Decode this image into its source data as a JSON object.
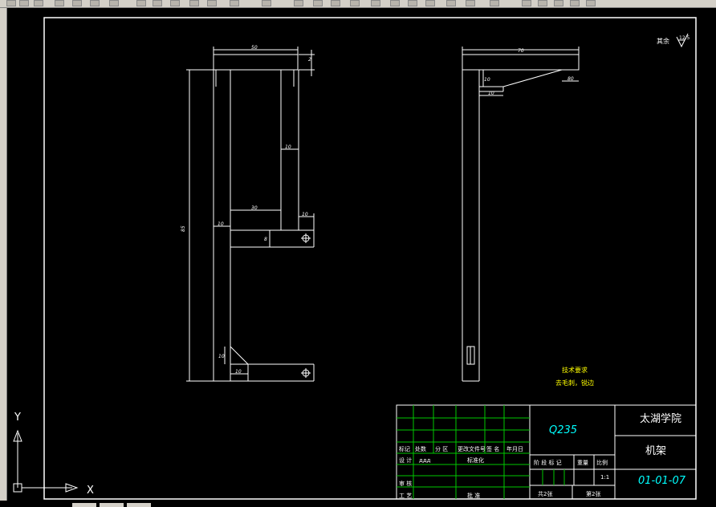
{
  "title_block": {
    "material": "Q235",
    "school": "太湖学院",
    "part_name": "机架",
    "drawing_no": "01-01-07",
    "headers": [
      "标记",
      "处数",
      "分 区",
      "更改文件号",
      "签 名",
      "年月日"
    ],
    "design_label": "设 计",
    "design_name": "ддд",
    "standardization_label": "标准化",
    "review_label": "审 核",
    "process_label": "工 艺",
    "approve_label": "批 准",
    "stage_label": "阶 段 标 记",
    "weight_label": "重量",
    "scale_label": "比例",
    "scale_value": "1:1",
    "sheets_total": "共2张",
    "sheet_number": "第2张"
  },
  "notes": {
    "tech_req_title": "技术要求",
    "tech_req_text": "去毛刺，锐边"
  },
  "roughness_label": "其余",
  "roughness_value": "12.5",
  "dimensions": {
    "top_width": "50",
    "top_thickness": "2",
    "height": "85",
    "inner_width": "30",
    "col_width": "10",
    "right_col": "10",
    "arm_end": "10",
    "arm_height": "8",
    "left_col": "10",
    "bottom_gusset_h": "10",
    "bottom_gusset_w": "10",
    "side_top_width": "70",
    "side_small_h": "10",
    "side_small_w": "10",
    "side_slope": "80"
  },
  "ucs": {
    "x_label": "X",
    "y_label": "Y"
  }
}
